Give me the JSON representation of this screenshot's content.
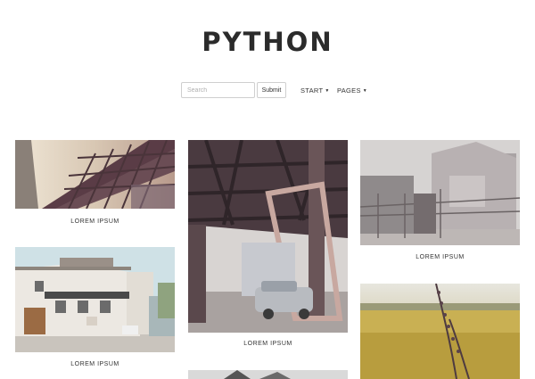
{
  "site": {
    "title": "PYTHON"
  },
  "search": {
    "placeholder": "Search",
    "submit_label": "Submit"
  },
  "nav": [
    {
      "label": "START",
      "caret": "▼"
    },
    {
      "label": "PAGES",
      "caret": "▼"
    }
  ],
  "gallery": [
    {
      "caption": "LOREM IPSUM"
    },
    {
      "caption": "LOREM IPSUM"
    },
    {
      "caption": "LOREM IPSUM"
    },
    {
      "caption": "LOREM IPSUM"
    }
  ]
}
